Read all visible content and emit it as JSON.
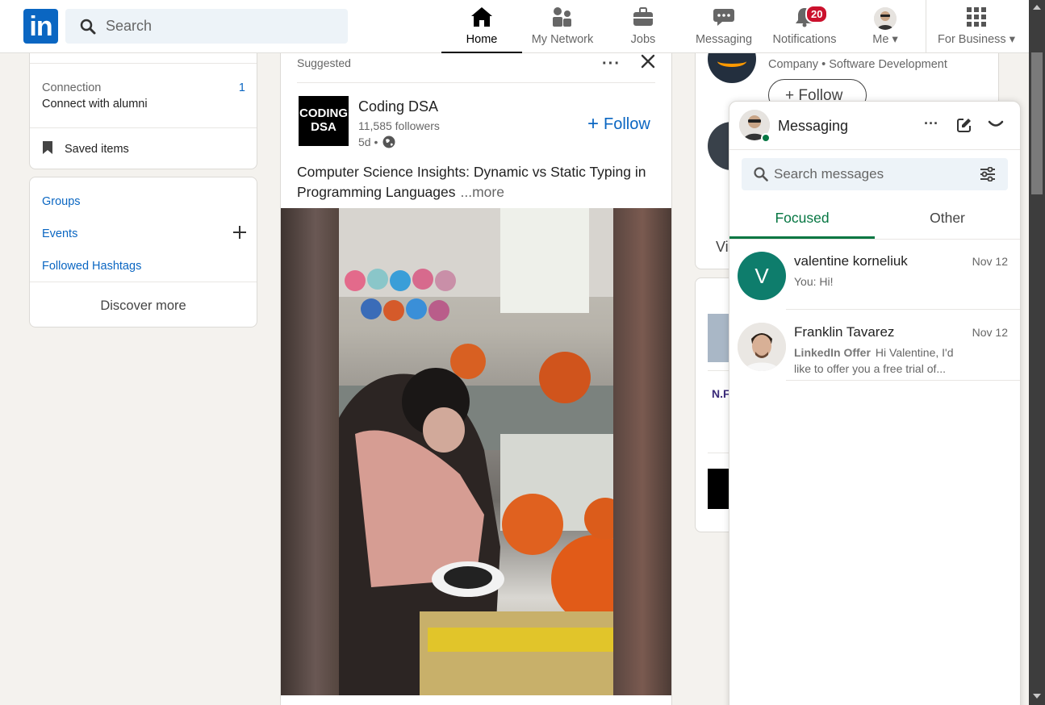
{
  "nav": {
    "logo": "in",
    "search_placeholder": "Search",
    "items": [
      {
        "label": "Home",
        "icon": "home-icon",
        "active": true
      },
      {
        "label": "My Network",
        "icon": "network-icon"
      },
      {
        "label": "Jobs",
        "icon": "briefcase-icon"
      },
      {
        "label": "Messaging",
        "icon": "chat-icon"
      },
      {
        "label": "Notifications",
        "icon": "bell-icon"
      },
      {
        "label": "Me",
        "icon": "avatar"
      },
      {
        "label": "For Business",
        "icon": "grid-icon"
      }
    ],
    "notifications_badge": "20"
  },
  "left": {
    "connection_title": "Connection",
    "connection_count": "1",
    "connection_sub": "Connect with alumni",
    "saved_items": "Saved items",
    "links": [
      "Groups",
      "Events",
      "Followed Hashtags"
    ],
    "discover_more": "Discover more"
  },
  "post": {
    "suggested": "Suggested",
    "company_logo_text": "CODING DSA",
    "company_name": "Coding DSA",
    "followers": "11,585 followers",
    "time": "5d •",
    "follow_label": "Follow",
    "text": "Computer Science Insights: Dynamic vs Static Typing in Programming Languages",
    "more": "...more"
  },
  "right": {
    "company_meta": "Company • Software Development",
    "follow_label": "Follow",
    "partial_text": "Vi",
    "partial_logo_text": "N.F"
  },
  "messaging": {
    "title": "Messaging",
    "search_placeholder": "Search messages",
    "tabs": [
      "Focused",
      "Other"
    ],
    "conversations": [
      {
        "initial": "V",
        "name": "valentine korneliuk",
        "date": "Nov 12",
        "snippet": "You: Hi!"
      },
      {
        "name": "Franklin Tavarez",
        "date": "Nov 12",
        "tag": "LinkedIn Offer",
        "snippet": "Hi Valentine, I'd like to offer you a free trial of..."
      }
    ]
  },
  "colors": {
    "brand": "#0a66c2",
    "accent_green": "#057642",
    "badge_red": "#cb112d"
  }
}
